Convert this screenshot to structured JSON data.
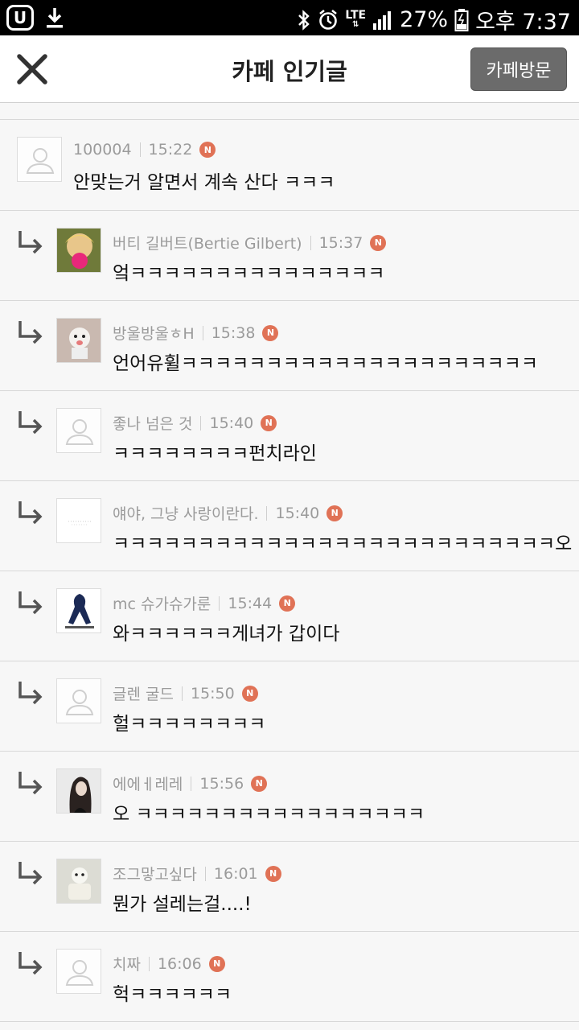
{
  "status_bar": {
    "network": "LTE",
    "battery": "27%",
    "time": "오후 7:37"
  },
  "header": {
    "title": "카페 인기글",
    "visit_label": "카페방문"
  },
  "comments": [
    {
      "author": "100004",
      "time": "15:22",
      "badge": "N",
      "text": "안맞는거 알면서 계속 산다 ㅋㅋㅋ"
    },
    {
      "author": "버티 길버트(Bertie Gilbert)",
      "time": "15:37",
      "badge": "N",
      "text": "엌ㅋㅋㅋㅋㅋㅋㅋㅋㅋㅋㅋㅋㅋㅋㅋ"
    },
    {
      "author": "방울방울ㅎH",
      "time": "15:38",
      "badge": "N",
      "text": "언어유휠ㅋㅋㅋㅋㅋㅋㅋㅋㅋㅋㅋㅋㅋㅋㅋㅋㅋㅋㅋㅋㅋ"
    },
    {
      "author": "좋나 넘은 것",
      "time": "15:40",
      "badge": "N",
      "text": "ㅋㅋㅋㅋㅋㅋㅋㅋ펀치라인"
    },
    {
      "author": "얘야, 그냥 사랑이란다.",
      "time": "15:40",
      "badge": "N",
      "text": "ㅋㅋㅋㅋㅋㅋㅋㅋㅋㅋㅋㅋㅋㅋㅋㅋㅋㅋㅋㅋㅋㅋㅋㅋㅋㅋ오"
    },
    {
      "author": "mc 슈가슈가룬",
      "time": "15:44",
      "badge": "N",
      "text": "와ㅋㅋㅋㅋㅋㅋ게녀가 갑이다"
    },
    {
      "author": "글렌 굴드",
      "time": "15:50",
      "badge": "N",
      "text": "헐ㅋㅋㅋㅋㅋㅋㅋㅋ"
    },
    {
      "author": "에에ㅔ레레",
      "time": "15:56",
      "badge": "N",
      "text": "오 ㅋㅋㅋㅋㅋㅋㅋㅋㅋㅋㅋㅋㅋㅋㅋㅋㅋ"
    },
    {
      "author": "조그맣고싶다",
      "time": "16:01",
      "badge": "N",
      "text": "뭔가 설레는걸....!"
    },
    {
      "author": "치짜",
      "time": "16:06",
      "badge": "N",
      "text": "헉ㅋㅋㅋㅋㅋㅋ"
    }
  ]
}
